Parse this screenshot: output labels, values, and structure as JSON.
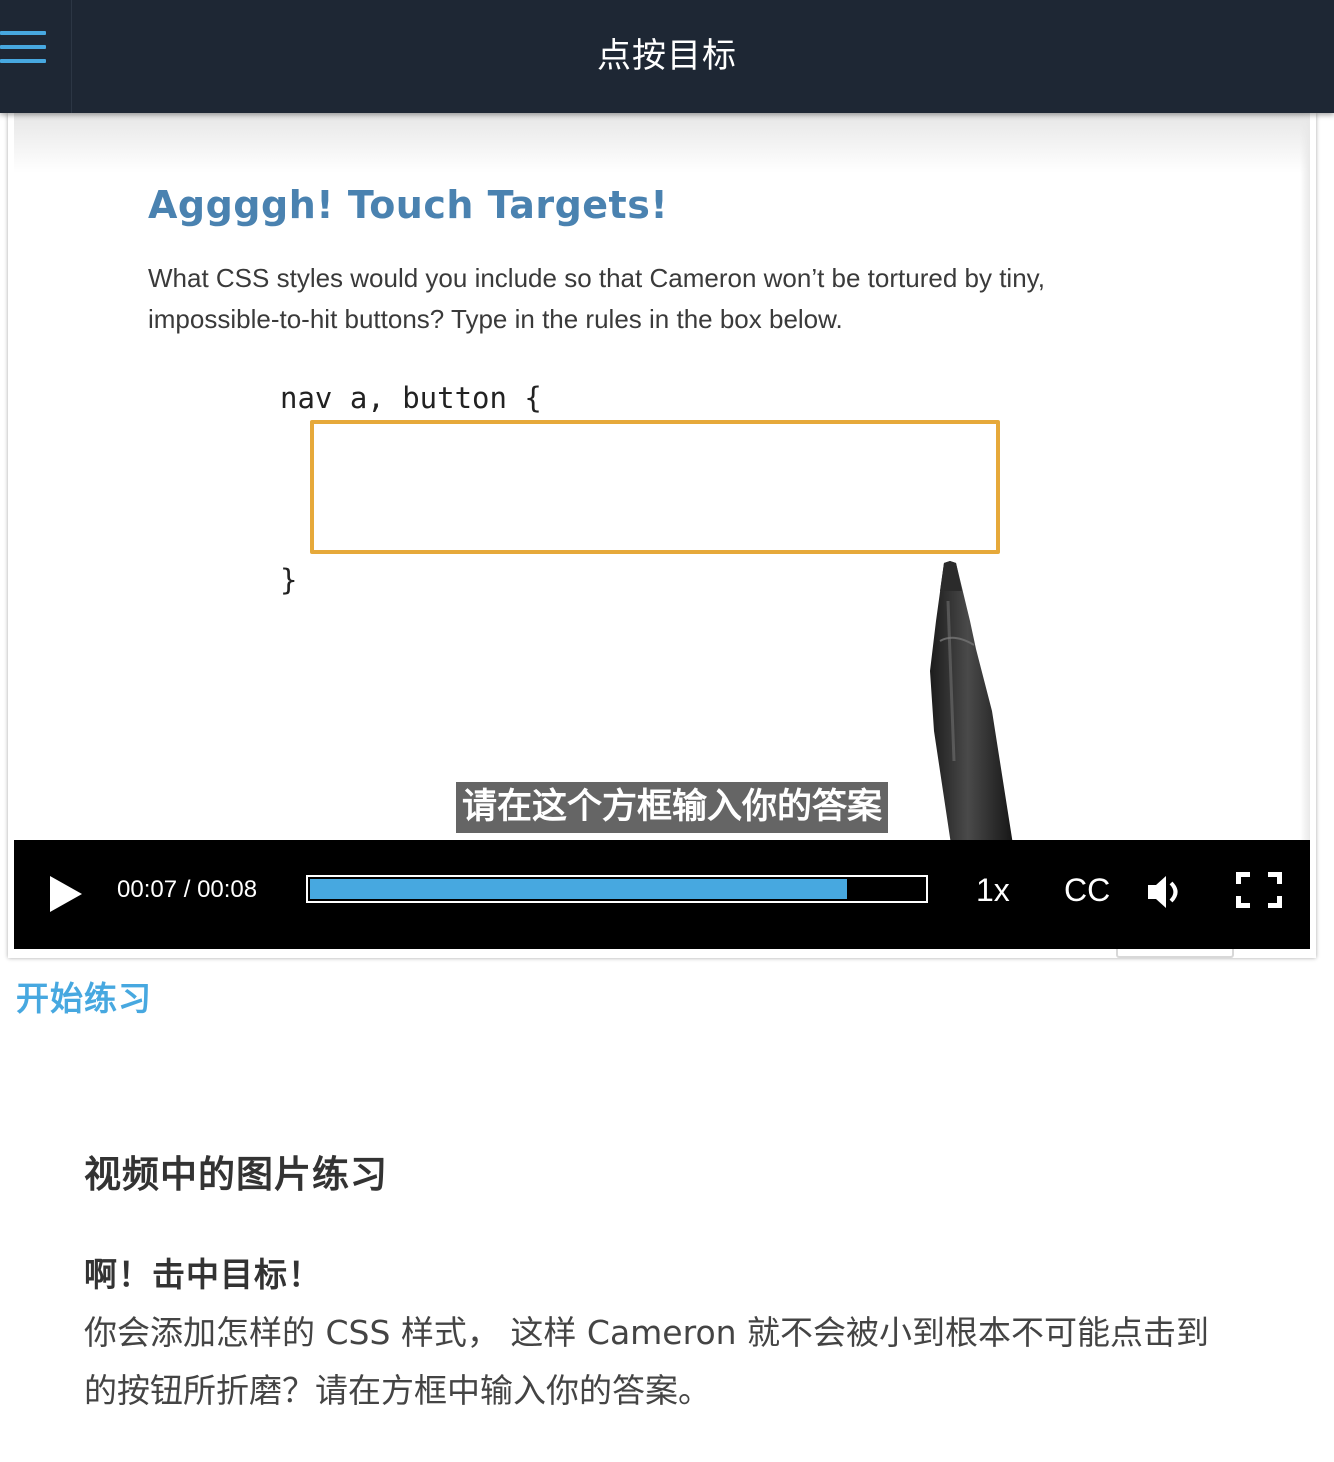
{
  "header": {
    "title": "点按目标",
    "menu_icon": "hamburger-menu-icon"
  },
  "video": {
    "slide": {
      "title": "Aggggh! Touch Targets!",
      "text": "What CSS styles would you include so that Cameron won’t be tortured by tiny, impossible-to-hit buttons? Type in the rules in the box below.",
      "code_open": "nav a, button {",
      "code_close": "}"
    },
    "subtitle": "请在这个方框输入你的答案",
    "controls": {
      "time": "00:07 / 00:08",
      "progress": 0.875,
      "speed": "1x",
      "cc": "CC",
      "play_icon": "play-icon",
      "volume_icon": "volume-icon",
      "fullscreen_icon": "fullscreen-icon"
    }
  },
  "start_practice": "开始练习",
  "section": {
    "heading": "视频中的图片练习",
    "subheading": "啊！击中目标！",
    "body": "你会添加怎样的 CSS 样式， 这样 Cameron 就不会被小到根本不可能点击到的按钮所折磨？请在方框中输入你的答案。"
  },
  "colors": {
    "appbar": "#1e2734",
    "accent": "#47a8e0",
    "answer_box": "#e6a93a",
    "slide_title": "#4a82b0"
  }
}
